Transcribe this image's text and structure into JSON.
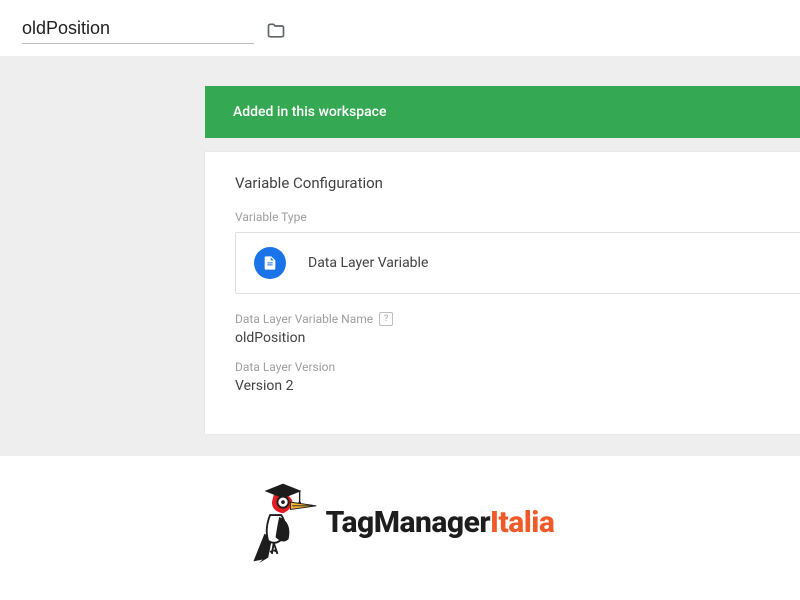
{
  "header": {
    "title_value": "oldPosition"
  },
  "banner": {
    "text": "Added in this workspace"
  },
  "card": {
    "title": "Variable Configuration",
    "type_label": "Variable Type",
    "type_value": "Data Layer Variable",
    "name_label": "Data Layer Variable Name",
    "name_help": "?",
    "name_value": "oldPosition",
    "version_label": "Data Layer Version",
    "version_value": "Version 2"
  },
  "logo": {
    "part1": "TagManager",
    "part2": "Italia"
  }
}
